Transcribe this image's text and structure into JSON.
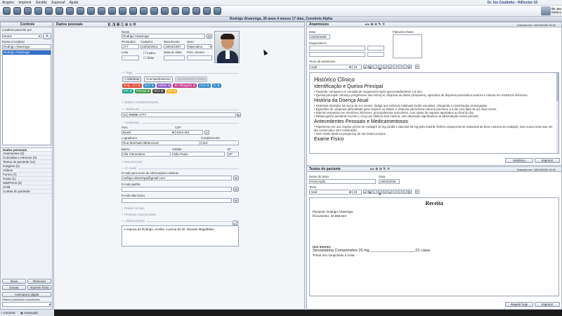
{
  "menu": [
    "Arquivo",
    "Imprimir",
    "Gestão",
    "Especial",
    "Ajuda"
  ],
  "menu_right": "Dr. Ivo Coutinho - HiDoctor 10",
  "user": {
    "name": "Dr. Ivo",
    "role": "Médico"
  },
  "status_title": "Rodrigo Alvarenga, 39 anos 4 meses 17 dias, Convênio Alpha",
  "controle": {
    "title": "Controle",
    "search_label": "Localizar paciente por",
    "search_by": "Nome",
    "name_label": "Nome a localizar",
    "name_value": "Rodrigo Alvarenga",
    "result": "Rodrigo Alvarenga"
  },
  "sidebar": {
    "header": "Dados pessoais",
    "items": [
      "Anamneses  (5)",
      "Consultas e retornos  (4)",
      "Textos do paciente  (11)",
      "Imagens  (2)",
      "Vídeos",
      "Forms  (7)",
      "Guias  (1)",
      "MiniPACS  (6)",
      "Child",
      "Contas do paciente"
    ]
  },
  "bottom_buttons": {
    "novo": "Novo",
    "remover": "Remover",
    "gravar": "Gravar",
    "imprimir": "Imprimir ficha",
    "assinatura": "Assinatura digital",
    "ultimos": "Últimos pacientes consultados",
    "iniciante": "Iniciante",
    "avancado": "Avançado"
  },
  "dados": {
    "title": "Dados pessoais",
    "nome_label": "Nome",
    "nome": "Rodrigo Alvarenga",
    "prontuario_label": "Prontuário",
    "prontuario": "177",
    "cadastro_label": "Cadastro",
    "cadastro": "22/02/2013",
    "nascimento_label": "Nascimento",
    "nascimento": "18/03/1987",
    "sexo_label": "Sexo",
    "sexo": "Masculino",
    "leito_label": "Leito",
    "leito": "--",
    "inativo": "Inativo",
    "obito": "Óbito",
    "data_obito_label": "Data do óbito",
    "prox_retorno_label": "Próx. retorno",
    "tags_sec": "Tags",
    "tag_add": "+ Adicionar",
    "tag_acomp": "Acompanhamento",
    "tag_agend": "Agendamento Online",
    "tags": [
      {
        "text": "desp. CCI",
        "color": "#e0442d"
      },
      {
        "text": "DLP",
        "color": "#2f86c9"
      },
      {
        "text": "Etilista",
        "color": "#8b52c4"
      },
      {
        "text": "Ex-Tabagista",
        "color": "#c43b8a"
      },
      {
        "text": "HAS",
        "color": "#2f86c9"
      },
      {
        "text": "IC",
        "color": "#2f86c9"
      },
      {
        "text": "PIX",
        "color": "#19a68e"
      },
      {
        "text": "Pontual",
        "color": "#3d9c4a"
      },
      {
        "text": "SCA",
        "color": "#444444"
      },
      {
        "text": "VIP",
        "color": "#f0b51c"
      }
    ],
    "compl_sec": "+ Dados complementares",
    "tel_sec": "Telefones",
    "telefone": "(11) 99999-1777",
    "end_sec": "Endereço",
    "pais_label": "País",
    "pais": "Brasil",
    "cep_label": "CEP",
    "cep": "4044-001",
    "logradouro_label": "Logradouro",
    "logradouro": "Rua Machado Bittencourt",
    "complemento_label": "Complemento",
    "complemento": "310",
    "bairro_label": "Bairro",
    "bairro": "Vila Clementino",
    "cidade_label": "Cidade",
    "cidade": "São Paulo",
    "uf_label": "UF",
    "uf": "SP",
    "docs_sec": "+ Documentos",
    "emails_sec": "E-mails",
    "email_med_label": "E-mail para envio de informações médicas",
    "email_med": "rodrigo.alvarenga@gmail.com",
    "email_padrao_label": "E-mail padrão",
    "email_alt_label": "E-mail alternativo",
    "redes_sec": "+ Redes sociais",
    "pessoas_sec": "+ Pessoas relacionadas",
    "obs_sec": "Observações",
    "obs": "A esposa do Rodrigo, Amélia, é prima do Dr. Ricardo Magalhães"
  },
  "anamneses": {
    "title": "Anamneses",
    "stamp": "Gravado em: 16/04/2026 15:42",
    "data_label": "Data",
    "data": "16/04/2026",
    "palavras_label": "Palavras-chave",
    "diag_label": "Diagnósticos",
    "texto_label": "Texto da anamnese",
    "font": "Arial",
    "size": "10",
    "doc_title": "Histórico Clínico",
    "h_queixa": "Identificação e Queixa Principal",
    "queixa": [
      "• Paciente comparece à consulta de seguimento após aproximadamente 1,5 ano.",
      "• Queixa principal: cansaço progressivo aos esforços, dispneia ao deitar (ortopneia), episódios de dispneia paroxística noturna e edema em membros inferiores."
    ],
    "h_hda": "História da Doença Atual",
    "hda": [
      "• Sintomas iniciados há cerca de 3-4 meses: fadiga aos esforços habituais (subir escadas), cheganda a caminhadas prolongadas.",
      "• Episódios de ortopneia (dificuldade para respirar ao deitar) e dispneia paroxística noturna (acordou à noite com falta de ar) duas vezes.",
      "• Edema vespertino em membros inferiores, principalmente tornozelos, com relato de sapatos apertados ao final do dia.",
      "• Relata ganho ponderal recente (~3 kg nos últimos dois meses), sem alteração significativa na alimentação nesse período."
    ],
    "h_app": "Antecedentes Pessoais e Medicamentosos",
    "app": [
      "• Hipertenso em uso regular prévio de enalapril 10 mg 2x/dia e atenolol 50 mg pela manhã. Refere esquecimento ocasional da dose noturna do enalapril, mas nunca mais que um dia consecutivo sem medicação.",
      "• Sem relato atual ou pregresso de dor torácica típica."
    ],
    "h_exame": "Exame Físico",
    "historico_btn": "Histórico",
    "imprimir_btn": "Imprimir"
  },
  "textos": {
    "title": "Textos do paciente",
    "stamp": "Gravado em: 16/04/2026 15:42",
    "nome_label": "Nome do texto",
    "nome": "Prescrição",
    "data_label": "Data",
    "data": "16/04/2026",
    "texto_label": "Texto",
    "font": "Arial",
    "size": "10",
    "receita": "Receita",
    "paciente": "Paciente:  Rodrigo Alvarenga",
    "documento": "Documento:  34.665.624",
    "uso": "Uso Interno:",
    "med": "Sinvastatina Comprimidos 20 mg _____________________01 caixa",
    "posologia": "Tomar um comprimido à noite.",
    "repetir_btn": "Repetir hoje",
    "imprimir_btn": "Imprimir"
  }
}
